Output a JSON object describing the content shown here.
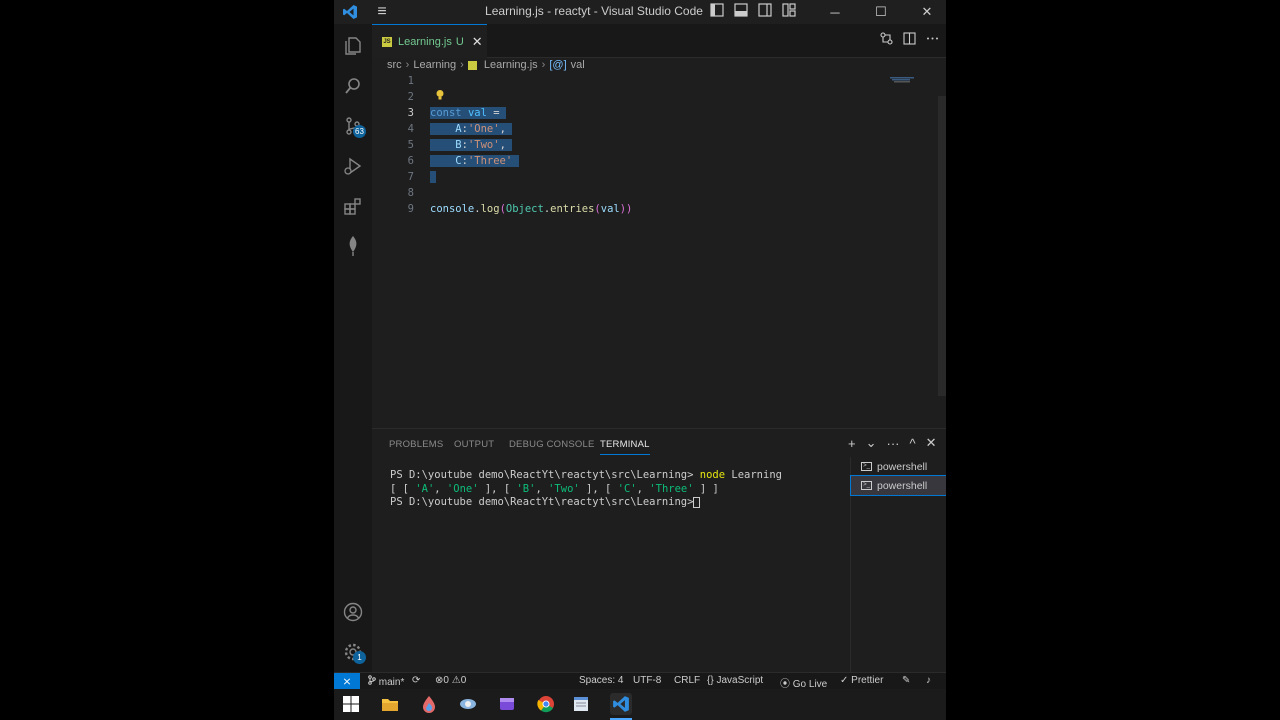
{
  "window": {
    "title": "Learning.js - reactyt - Visual Studio Code",
    "controls": {
      "minimize": "─",
      "maximize": "☐",
      "close": "✕"
    },
    "menu_icon": "≡"
  },
  "activity_bar": {
    "items": [
      {
        "name": "explorer-icon"
      },
      {
        "name": "search-icon"
      },
      {
        "name": "source-control-icon",
        "badge": "63"
      },
      {
        "name": "run-debug-icon"
      },
      {
        "name": "extensions-icon"
      },
      {
        "name": "mongodb-leaf-icon"
      }
    ],
    "bottom": [
      {
        "name": "account-icon"
      },
      {
        "name": "settings-gear-icon",
        "badge": "1"
      }
    ]
  },
  "tabs": [
    {
      "label": "Learning.js",
      "status": "U",
      "icon": "JS",
      "close": "✕"
    }
  ],
  "breadcrumb": {
    "items": [
      "src",
      "Learning",
      "Learning.js",
      "val"
    ],
    "symbol_prefix": "[@]"
  },
  "editor": {
    "line_numbers": [
      "1",
      "2",
      "3",
      "4",
      "5",
      "6",
      "7",
      "8",
      "9"
    ],
    "active_line": "3",
    "lines": {
      "l3": {
        "kw": "const",
        "var": "val",
        "op": "="
      },
      "l4": {
        "key": "A",
        "val": "'One'"
      },
      "l5": {
        "key": "B",
        "val": "'Two'"
      },
      "l6": {
        "key": "C",
        "val": "'Three'"
      },
      "l9": {
        "obj": "console",
        "method": "log",
        "cls": "Object",
        "fn": "entries",
        "arg": "val"
      }
    }
  },
  "panel": {
    "tabs": [
      "PROBLEMS",
      "OUTPUT",
      "DEBUG CONSOLE",
      "TERMINAL"
    ],
    "active_tab": "TERMINAL",
    "actions": {
      "add": "+",
      "dropdown": "⌄",
      "more": "···",
      "maximize": "^",
      "close": "✕"
    },
    "terminal": {
      "prompt": "PS D:\\youtube demo\\ReactYt\\reactyt\\src\\Learning>",
      "command": "node",
      "command_arg": "Learning",
      "output": {
        "open": "[ [",
        "a": "'A'",
        "one": "'One'",
        "mid1": "], [",
        "b": "'B'",
        "two": "'Two'",
        "mid2": "], [",
        "c": "'C'",
        "three": "'Three'",
        "close": "] ]"
      }
    },
    "terminal_list": [
      "powershell",
      "powershell"
    ]
  },
  "status_bar": {
    "remote": "⨯",
    "branch": "main*",
    "sync": "⟳",
    "errors": "0",
    "warnings": "0",
    "spaces": "Spaces: 4",
    "encoding": "UTF-8",
    "eol": "CRLF",
    "language_prefix": "{}",
    "language": "JavaScript",
    "go_live": "Go Live",
    "prettier": "Prettier"
  },
  "taskbar": {
    "items": [
      "windows-start-icon",
      "file-explorer-icon",
      "paint-icon",
      "app-icon",
      "media-icon",
      "chrome-icon",
      "notepad-icon",
      "vscode-icon"
    ]
  },
  "colors": {
    "accent": "#0078d4",
    "selection": "#264f78",
    "keyword": "#569cd6",
    "string": "#ce9178",
    "function": "#dcdcaa",
    "class": "#4ec9b0",
    "untracked": "#73c991"
  }
}
